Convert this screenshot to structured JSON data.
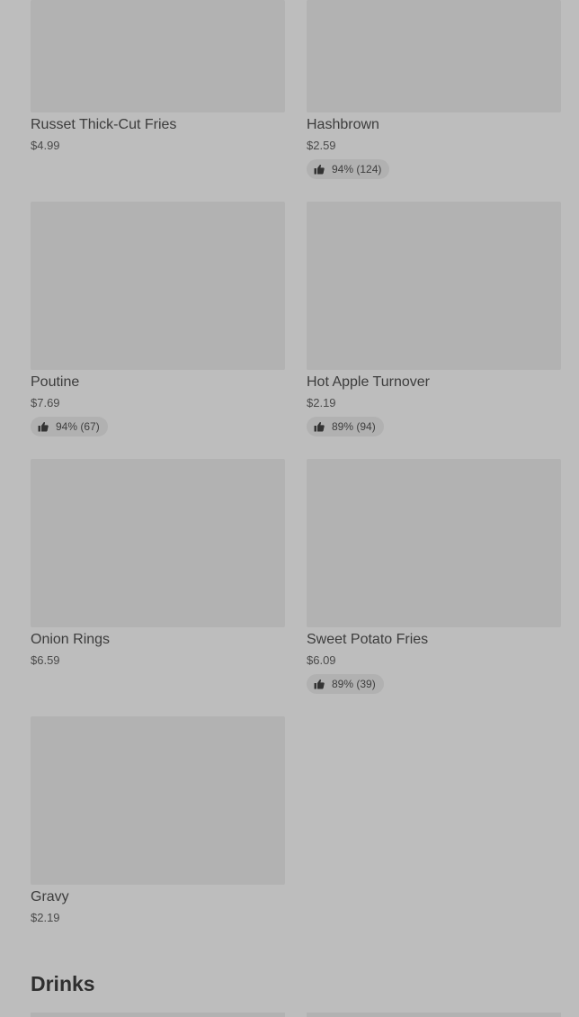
{
  "items": [
    {
      "name": "Russet Thick-Cut Fries",
      "price": "$4.99"
    },
    {
      "name": "Hashbrown",
      "price": "$2.59",
      "rating": "94% (124)"
    },
    {
      "name": "Poutine",
      "price": "$7.69",
      "rating": "94% (67)"
    },
    {
      "name": "Hot Apple Turnover",
      "price": "$2.19",
      "rating": "89% (94)"
    },
    {
      "name": "Onion Rings",
      "price": "$6.59"
    },
    {
      "name": "Sweet Potato Fries",
      "price": "$6.09",
      "rating": "89% (39)"
    },
    {
      "name": "Gravy",
      "price": "$2.19"
    }
  ],
  "sections": {
    "drinks": {
      "title": "Drinks"
    }
  },
  "icons": {
    "rating": "thumbs-up-icon"
  },
  "colors": {
    "background": "#bdbdbd",
    "thumbnail": "#b2b2b2",
    "rating_pill": "#b1b1b1"
  }
}
